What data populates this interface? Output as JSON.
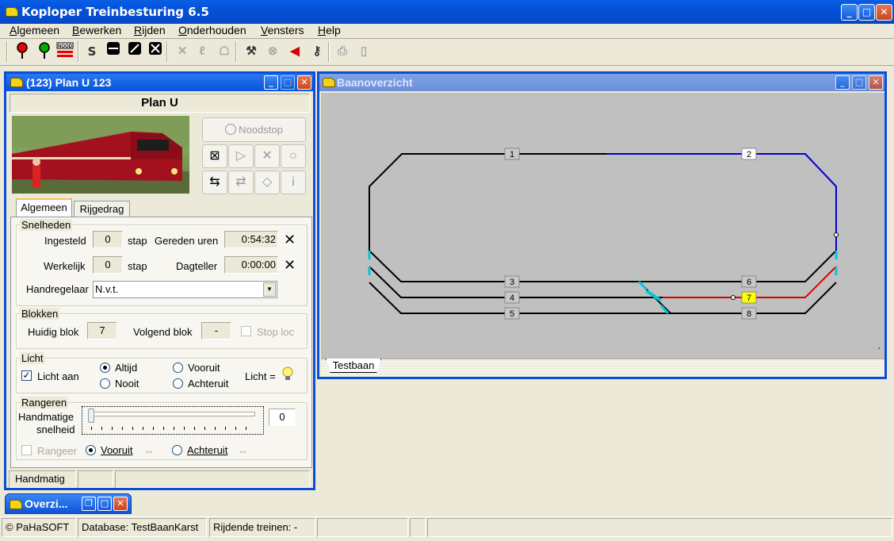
{
  "app": {
    "title": "Koploper Treinbesturing 6.5",
    "menu": [
      "Algemeen",
      "Bewerken",
      "Rijden",
      "Onderhouden",
      "Vensters",
      "Help"
    ],
    "toolbar_icons": [
      "red-signal-icon",
      "green-signal-icon",
      "nood-icon",
      "s-icon",
      "block-icon",
      "diagonal-icon",
      "x-block-icon",
      "walk-off-icon",
      "person-off-icon",
      "ghost-icon",
      "hammer-icon",
      "no-icon",
      "speaker-icon",
      "key-icon",
      "print-icon",
      "page-icon"
    ],
    "toolbar_labels": {
      "s": "S",
      "nood": "NOOD"
    }
  },
  "loco_window": {
    "title": "(123) Plan U 123",
    "heading": "Plan U",
    "noodstop_label": "Noodstop",
    "tabs": [
      "Algemeen",
      "Rijgedrag"
    ],
    "snelheden": {
      "group_title": "Snelheden",
      "ingesteld_label": "Ingesteld",
      "ingesteld_value": "0",
      "stap1": "stap",
      "gereden_label": "Gereden uren",
      "gereden_value": "0:54:32",
      "werkelijk_label": "Werkelijk",
      "werkelijk_value": "0",
      "stap2": "stap",
      "dagteller_label": "Dagteller",
      "dagteller_value": "0:00:00",
      "handregelaar_label": "Handregelaar",
      "handregelaar_value": "N.v.t."
    },
    "blokken": {
      "group_title": "Blokken",
      "huidig_label": "Huidig blok",
      "huidig_value": "7",
      "volgend_label": "Volgend blok",
      "volgend_value": "-",
      "stoploc_label": "Stop loc"
    },
    "licht": {
      "group_title": "Licht",
      "licht_aan_label": "Licht aan",
      "altijd": "Altijd",
      "nooit": "Nooit",
      "vooruit": "Vooruit",
      "achteruit": "Achteruit",
      "licht_eq": "Licht ="
    },
    "rangeren": {
      "group_title": "Rangeren",
      "handmatige": "Handmatige",
      "snelheid": "snelheid",
      "speed_value": "0",
      "rangeer_label": "Rangeer",
      "vooruit": "Vooruit",
      "achteruit": "Achteruit"
    },
    "status": "Handmatig"
  },
  "track_window": {
    "title": "Baanoverzicht",
    "tab": "Testbaan",
    "blocks": [
      "1",
      "2",
      "3",
      "4",
      "5",
      "6",
      "7",
      "8"
    ],
    "active_block": "7",
    "colors": {
      "track": "#000000",
      "blue": "#0000cc",
      "red": "#e00000",
      "cyan": "#00c8d8",
      "active_block_bg": "#ffff00"
    }
  },
  "minimized": {
    "title": "Overzi..."
  },
  "statusbar": {
    "copyright": "© PaHaSOFT",
    "database": "Database: TestBaanKarst",
    "rijdende": "Rijdende treinen: -"
  }
}
